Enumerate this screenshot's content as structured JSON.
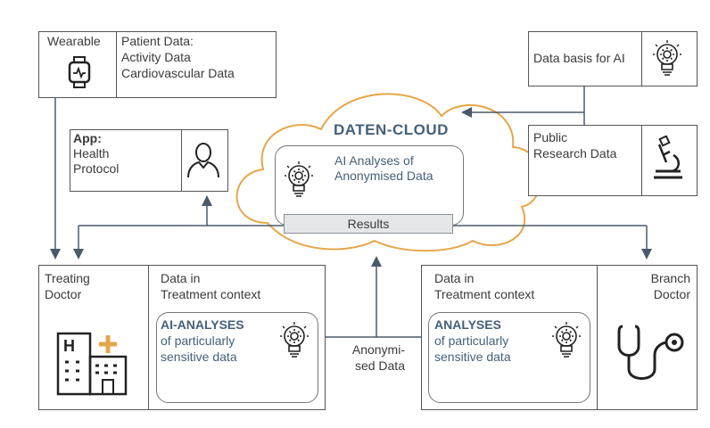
{
  "wearable": {
    "title": "Wearable",
    "patient_data_title": "Patient Data:",
    "patient_data_line1": "Activity Data",
    "patient_data_line2": "Cardiovascular Data"
  },
  "app": {
    "title": "App:",
    "line1": "Health",
    "line2": "Protocol"
  },
  "data_basis": {
    "label": "Data basis for AI"
  },
  "public_research": {
    "line1": "Public",
    "line2": "Research Data"
  },
  "cloud": {
    "title": "DATEN-CLOUD",
    "analyses_line1": "AI Analyses of",
    "analyses_line2": "Anonymised Data",
    "results": "Results"
  },
  "treating_doctor": {
    "line1": "Treating",
    "line2": "Doctor",
    "context_line1": "Data in",
    "context_line2": "Treatment context",
    "analyses_title": "AI-ANALYSES",
    "analyses_line1": "of particularly",
    "analyses_line2": "sensitive data"
  },
  "branch_doctor": {
    "line1": "Branch",
    "line2": "Doctor",
    "context_line1": "Data in",
    "context_line2": "Treatment context",
    "analyses_title": "ANALYSES",
    "analyses_line1": "of particularly",
    "analyses_line2": "sensitive data"
  },
  "anonymised": {
    "line1": "Anonymi-",
    "line2": "sed Data"
  },
  "colors": {
    "cloud_outline": "#e5a64a",
    "accent_text": "#44607a",
    "line": "#4a5a6a"
  }
}
